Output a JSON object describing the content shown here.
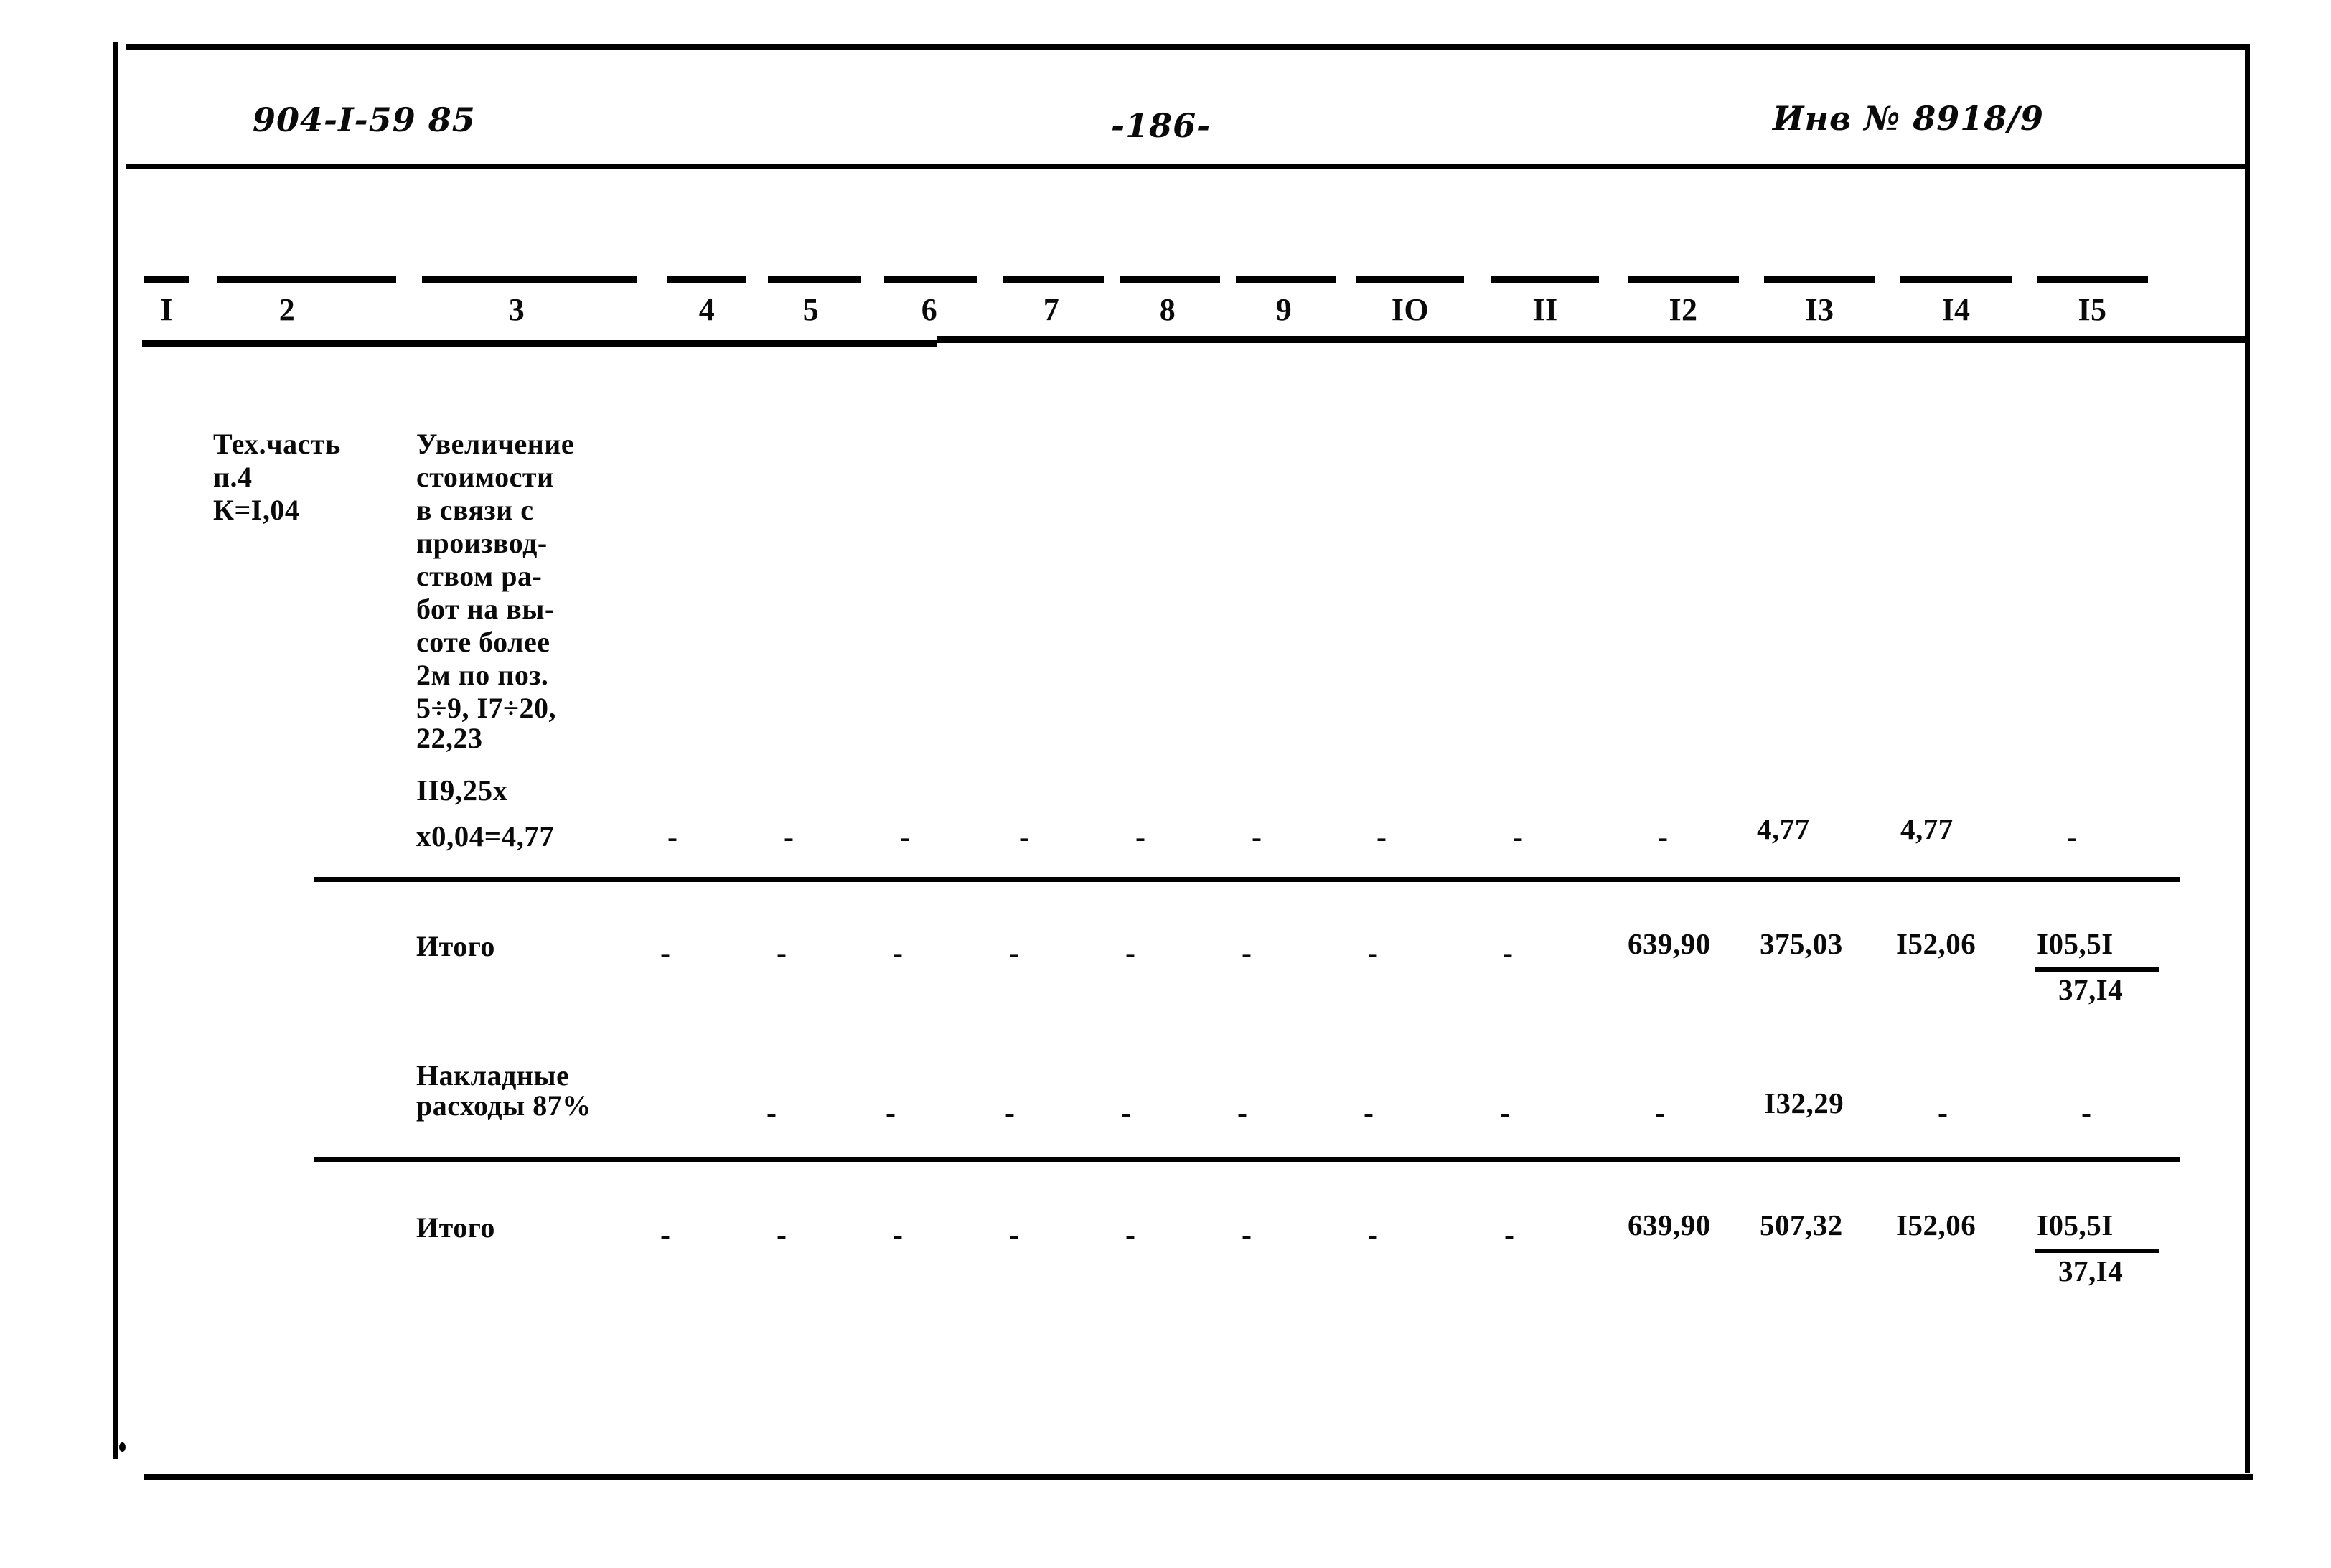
{
  "document": {
    "sheet_code": "904-I-59 85",
    "page_number": "-186-",
    "inventory": "Инв № 8918/9"
  },
  "table": {
    "column_numbers": [
      "I",
      "2",
      "3",
      "4",
      "5",
      "6",
      "7",
      "8",
      "9",
      "IO",
      "II",
      "I2",
      "I3",
      "I4",
      "I5"
    ],
    "rows": [
      {
        "name": "tech-part-row",
        "col1": [
          "Тех.часть",
          "п.4",
          "К=I,04"
        ],
        "col3": [
          "Увеличение",
          "стоимости",
          "в связи с",
          "производ-",
          "ством ра-",
          "бот на вы-",
          "соте более",
          "2м по поз.",
          "5÷9, I7÷20,",
          "22,23"
        ],
        "calc": [
          "II9,25х",
          "х0,04=4,77"
        ],
        "values": {
          "c4": "-",
          "c5": "-",
          "c6": "-",
          "c7": "-",
          "c8": "-",
          "c9": "-",
          "c10": "-",
          "c11": "-",
          "c12": "-",
          "c13": "4,77",
          "c14": "4,77",
          "c15": "-"
        }
      },
      {
        "name": "itogo-row-1",
        "label": "Итого",
        "values": {
          "c4": "-",
          "c5": "-",
          "c6": "-",
          "c7": "-",
          "c8": "-",
          "c9": "-",
          "c10": "-",
          "c11": "-",
          "c12": "639,90",
          "c13": "375,03",
          "c14": "I52,06",
          "c15_numerator": "I05,5I",
          "c15_denominator": "37,I4"
        }
      },
      {
        "name": "overhead-row",
        "label_line1": "Накладные",
        "label_line2": "расходы 87%",
        "values": {
          "c4": "-",
          "c5": "-",
          "c6": "-",
          "c7": "-",
          "c8": "-",
          "c9": "-",
          "c10": "-",
          "c11": "-",
          "c12": "-",
          "c13": "I32,29",
          "c14": "-",
          "c15": "-"
        }
      },
      {
        "name": "itogo-row-2",
        "label": "Итого",
        "values": {
          "c4": "-",
          "c5": "-",
          "c6": "-",
          "c7": "-",
          "c8": "-",
          "c9": "-",
          "c10": "-",
          "c11": "-",
          "c12": "639,90",
          "c13": "507,32",
          "c14": "I52,06",
          "c15_numerator": "I05,5I",
          "c15_denominator": "37,I4"
        }
      }
    ]
  },
  "colors": {
    "ink": "#000000",
    "paper": "#ffffff"
  }
}
